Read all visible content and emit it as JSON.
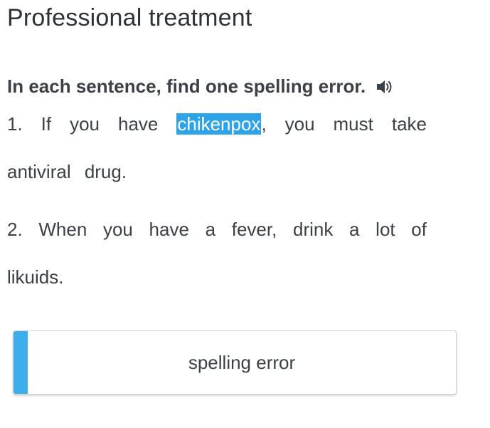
{
  "page": {
    "title": "Professional treatment",
    "instruction": "In each sentence, find one spelling error."
  },
  "icons": {
    "audio": "speaker-icon"
  },
  "sentences": [
    {
      "number": "1.",
      "before": "If you have",
      "selected_word": "chikenpox",
      "after": ", you must take antiviral drug."
    },
    {
      "number": "2.",
      "text": "When you have a fever, drink a lot of likuids."
    }
  ],
  "answer": {
    "label": "spelling error"
  },
  "colors": {
    "highlight": "#2fa3e8",
    "accent_bar": "#3daeea",
    "text": "#3c4147"
  }
}
